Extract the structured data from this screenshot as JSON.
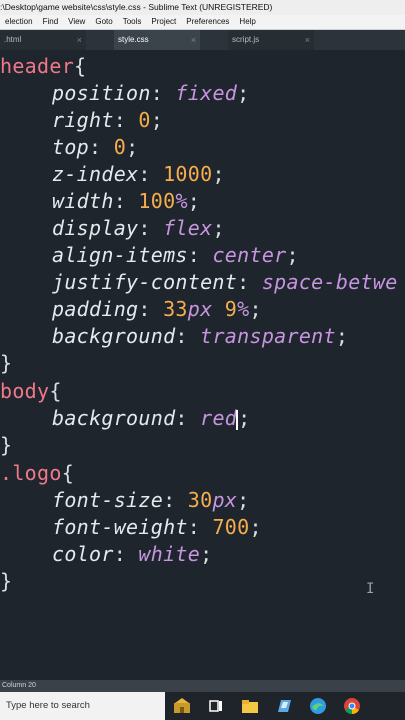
{
  "window": {
    "title": ":\\Desktop\\game website\\css\\style.css - Sublime Text (UNREGISTERED)"
  },
  "menu": [
    "election",
    "Find",
    "View",
    "Goto",
    "Tools",
    "Project",
    "Preferences",
    "Help"
  ],
  "tabs": [
    {
      "label": ".html",
      "close": "×",
      "active": false
    },
    {
      "label": "style.css",
      "close": "×",
      "active": true
    },
    {
      "label": "script.js",
      "close": "×",
      "active": false
    }
  ],
  "code": {
    "l1": {
      "sel": "header",
      "brace": "{"
    },
    "l2": {
      "prop": "position",
      "sep": ": ",
      "val": "fixed",
      "end": ";"
    },
    "l3": {
      "prop": "right",
      "sep": ": ",
      "val": "0",
      "end": ";"
    },
    "l4": {
      "prop": "top",
      "sep": ": ",
      "val": "0",
      "end": ";"
    },
    "l5": {
      "prop": "z-index",
      "sep": ": ",
      "val": "1000",
      "end": ";"
    },
    "l6": {
      "prop": "width",
      "sep": ": ",
      "num": "100",
      "unit": "%",
      "end": ";"
    },
    "l7": {
      "prop": "display",
      "sep": ": ",
      "val": "flex",
      "end": ";"
    },
    "l8": {
      "prop": "align-items",
      "sep": ": ",
      "val": "center",
      "end": ";"
    },
    "l9": {
      "prop": "justify-content",
      "sep": ": ",
      "val": "space-betwe"
    },
    "l10": {
      "prop": "padding",
      "sep": ": ",
      "num1": "33",
      "unit1": "px",
      "num2": "9",
      "unit2": "%",
      "end": ";"
    },
    "l11": {
      "prop": "background",
      "sep": ": ",
      "val": "transparent",
      "end": ";"
    },
    "l12": {
      "brace": "}"
    },
    "l13": {
      "sel": "body",
      "brace": "{"
    },
    "l14": {
      "prop": "background",
      "sep": ": ",
      "val": "red",
      "end": ";"
    },
    "l15": {
      "brace": "}"
    },
    "l16": {
      "sel": ".logo",
      "brace": "{"
    },
    "l17": {
      "prop": "font-size",
      "sep": ": ",
      "num": "30",
      "unit": "px",
      "end": ";"
    },
    "l18": {
      "prop": "font-weight",
      "sep": ": ",
      "val": "700",
      "end": ";"
    },
    "l19": {
      "prop": "color",
      "sep": ": ",
      "val": "white",
      "end": ";"
    },
    "l20": {
      "brace": "}"
    }
  },
  "status": {
    "text": "Column 20"
  },
  "taskbar": {
    "search_placeholder": "Type here to search"
  },
  "colors": {
    "background": "#1e252c",
    "selector": "#f0788a",
    "number": "#f7ad4d",
    "keyword": "#c795df"
  }
}
